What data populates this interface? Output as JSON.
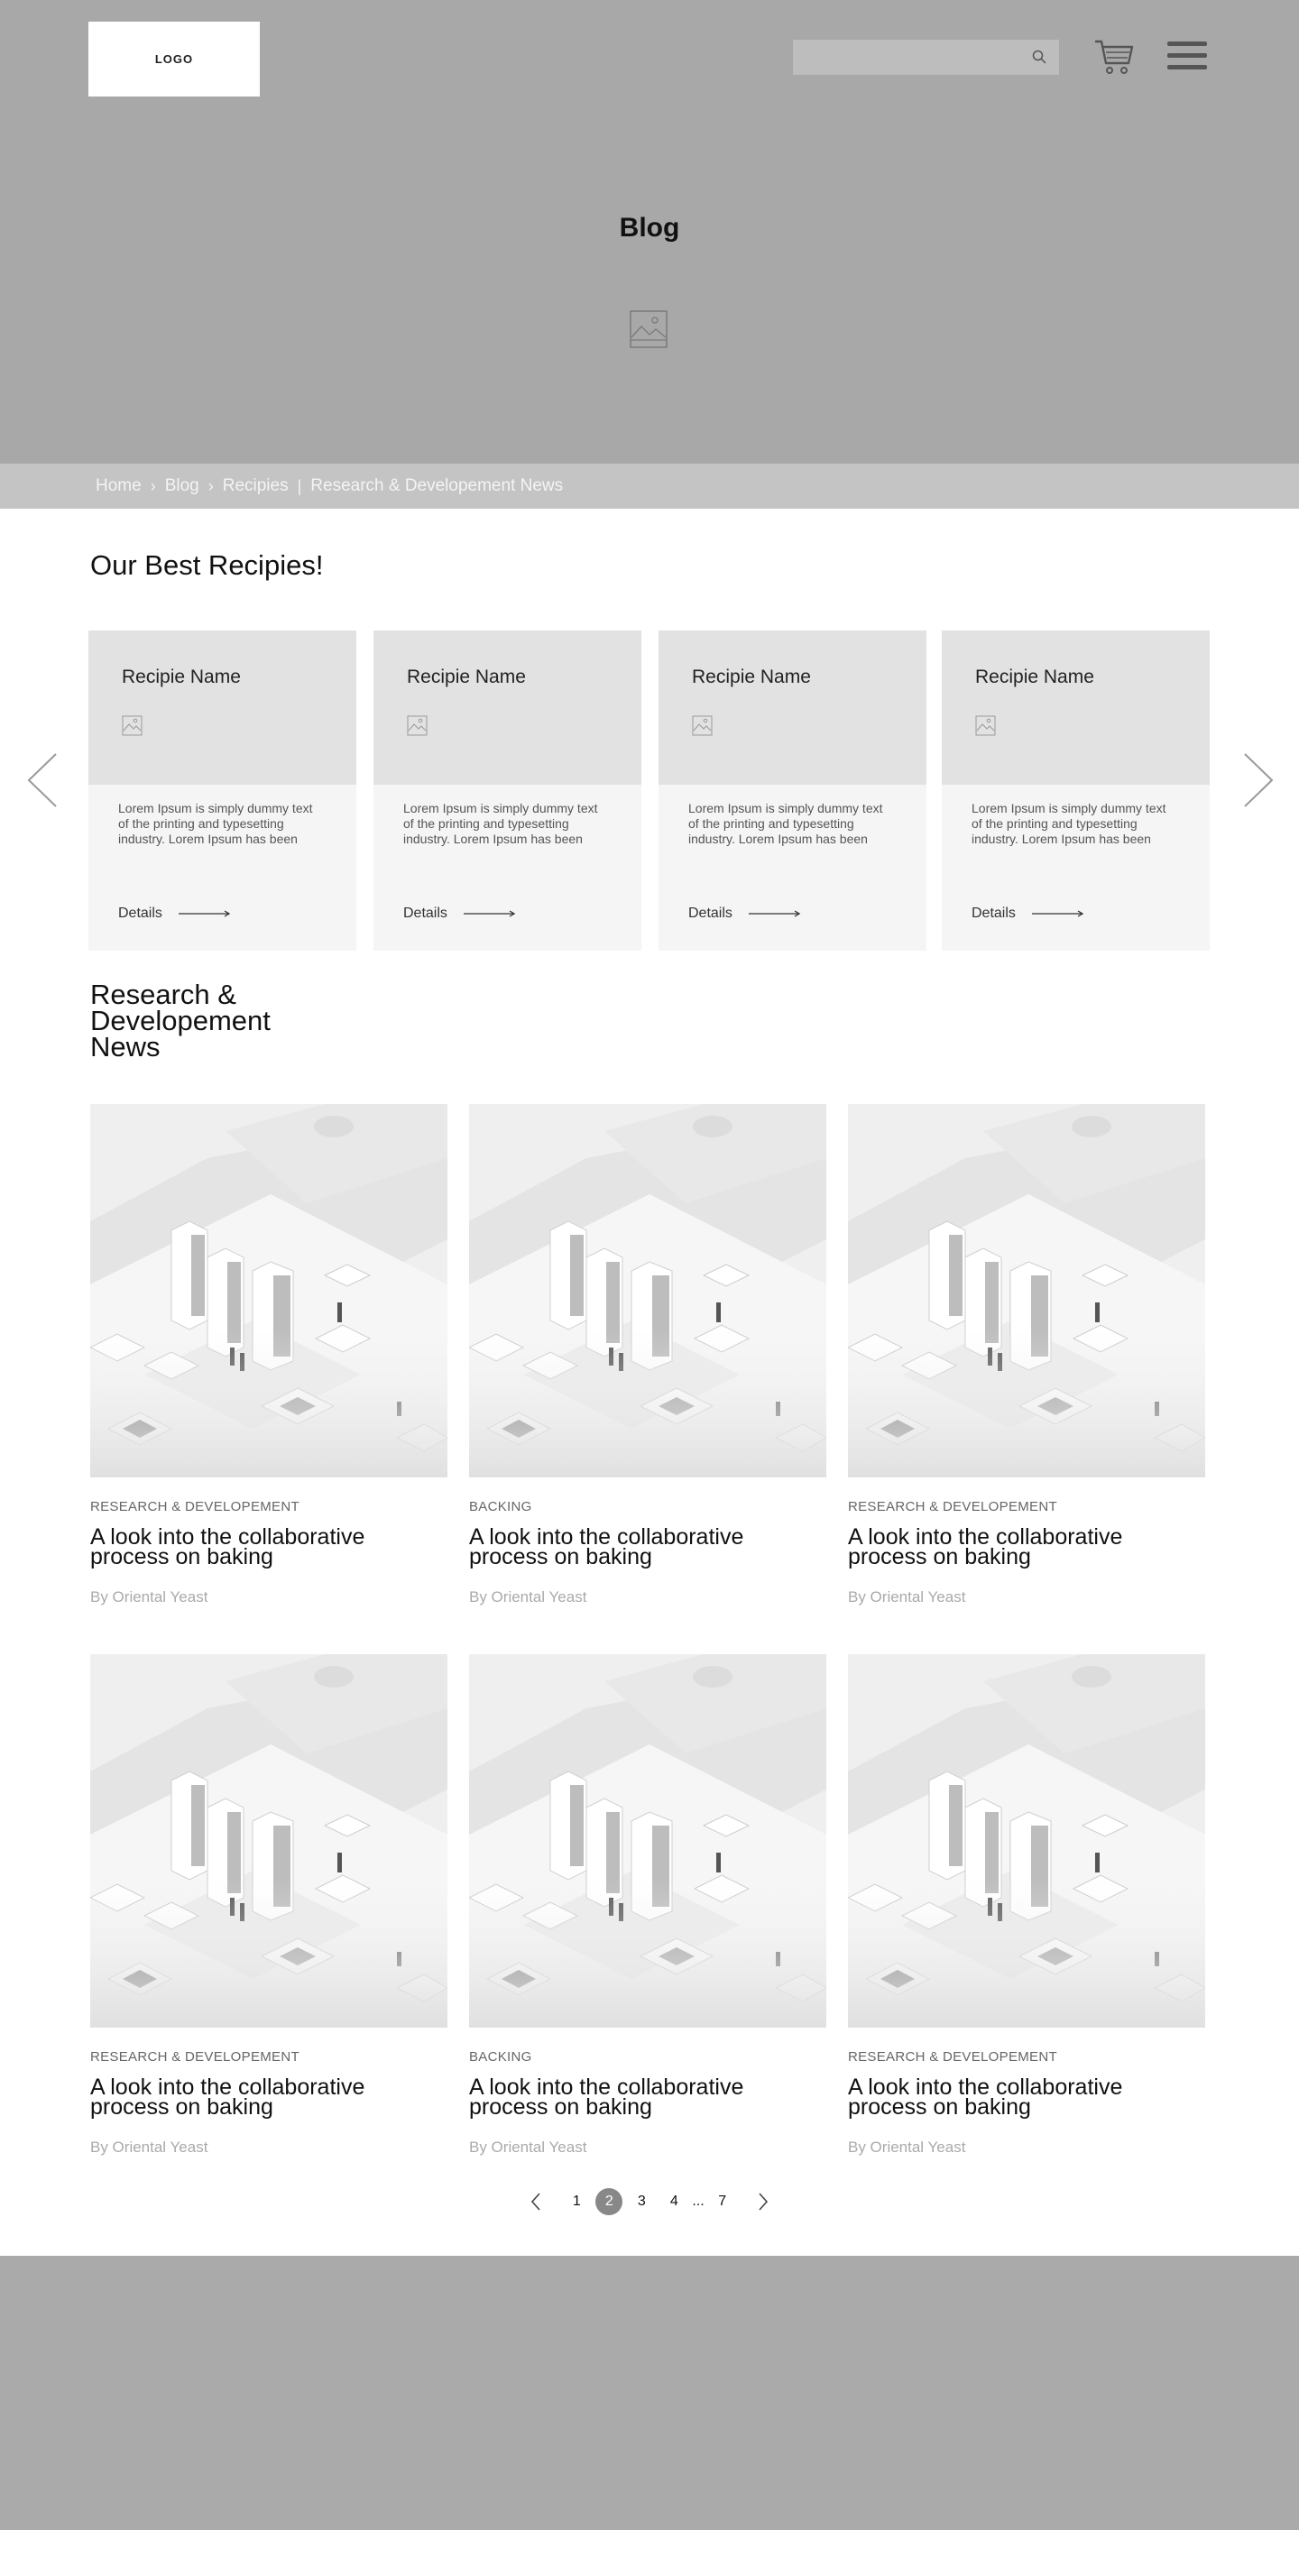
{
  "header": {
    "logo": "LOGO",
    "search_placeholder": "",
    "icons": [
      "search-icon",
      "cart-icon",
      "hamburger-menu-icon"
    ]
  },
  "hero": {
    "title": "Blog",
    "image_icon": "image-placeholder-icon"
  },
  "breadcrumb": {
    "items": [
      "Home",
      "Blog",
      "Recipies",
      "Research & Developement News"
    ],
    "separators": [
      "›",
      "›",
      "|"
    ]
  },
  "recipes": {
    "title": "Our Best Recipies!",
    "cards": [
      {
        "name": "Recipie Name",
        "description": "Lorem Ipsum is simply dummy text of the printing and typesetting industry. Lorem Ipsum has been",
        "link": "Details"
      },
      {
        "name": "Recipie Name",
        "description": "Lorem Ipsum is simply dummy text of the printing and typesetting industry. Lorem Ipsum has been",
        "link": "Details"
      },
      {
        "name": "Recipie Name",
        "description": "Lorem Ipsum is simply dummy text of the printing and typesetting industry. Lorem Ipsum has been",
        "link": "Details"
      },
      {
        "name": "Recipie Name",
        "description": "Lorem Ipsum is simply dummy text of the printing and typesetting industry. Lorem Ipsum has been",
        "link": "Details"
      }
    ]
  },
  "news": {
    "title": "Research & Developement News",
    "posts": [
      {
        "category": "RESEARCH & DEVELOPEMENT",
        "title": "A look into the collaborative process on baking",
        "author": "By Oriental Yeast"
      },
      {
        "category": "BACKING",
        "title": "A look into the collaborative process on baking",
        "author": "By Oriental Yeast"
      },
      {
        "category": "RESEARCH & DEVELOPEMENT",
        "title": "A look into the collaborative process on baking",
        "author": "By Oriental Yeast"
      },
      {
        "category": "RESEARCH & DEVELOPEMENT",
        "title": "A look into the collaborative process on baking",
        "author": "By Oriental Yeast"
      },
      {
        "category": "BACKING",
        "title": "A look into the collaborative process on baking",
        "author": "By Oriental Yeast"
      },
      {
        "category": "RESEARCH & DEVELOPEMENT",
        "title": "A look into the collaborative process on baking",
        "author": "By Oriental Yeast"
      }
    ]
  },
  "pagination": {
    "pages": [
      "1",
      "2",
      "3",
      "4"
    ],
    "ellipsis": "...",
    "last": "7",
    "current": "2"
  },
  "colors": {
    "header_bg": "#a8a8a8",
    "breadcrumb_bg": "#c4c4c4",
    "card_top": "#e2e2e2",
    "card_bottom": "#f5f5f5",
    "footer_bg": "#aaaaaa",
    "active_page": "#888888"
  }
}
